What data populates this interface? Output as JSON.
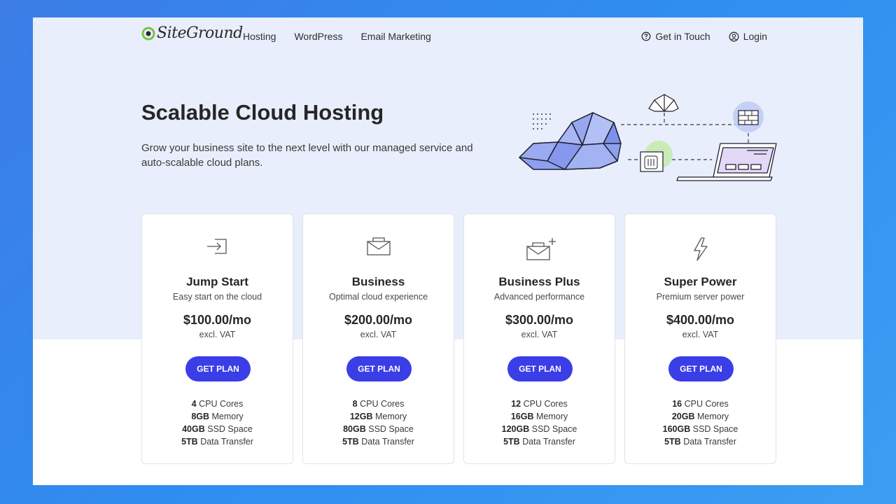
{
  "brand": {
    "name": "SiteGround",
    "accent": "#3b3ee6",
    "logo_green": "#7cc242"
  },
  "nav": {
    "links": [
      "Hosting",
      "WordPress",
      "Email Marketing"
    ],
    "contact_label": "Get in Touch",
    "login_label": "Login"
  },
  "hero": {
    "title": "Scalable Cloud Hosting",
    "subtitle": "Grow your business site to the next level with our managed service and auto-scalable cloud plans."
  },
  "plans": [
    {
      "icon": "arrow-into-box-icon",
      "name": "Jump Start",
      "tagline": "Easy start on the cloud",
      "price": "$100.00/mo",
      "vat": "excl. VAT",
      "cta": "GET PLAN",
      "specs": [
        {
          "value": "4",
          "label": "CPU Cores"
        },
        {
          "value": "8GB",
          "label": "Memory"
        },
        {
          "value": "40GB",
          "label": "SSD Space"
        },
        {
          "value": "5TB",
          "label": "Data Transfer"
        }
      ]
    },
    {
      "icon": "envelope-icon",
      "name": "Business",
      "tagline": "Optimal cloud experience",
      "price": "$200.00/mo",
      "vat": "excl. VAT",
      "cta": "GET PLAN",
      "specs": [
        {
          "value": "8",
          "label": "CPU Cores"
        },
        {
          "value": "12GB",
          "label": "Memory"
        },
        {
          "value": "80GB",
          "label": "SSD Space"
        },
        {
          "value": "5TB",
          "label": "Data Transfer"
        }
      ]
    },
    {
      "icon": "envelope-plus-icon",
      "name": "Business Plus",
      "tagline": "Advanced performance",
      "price": "$300.00/mo",
      "vat": "excl. VAT",
      "cta": "GET PLAN",
      "specs": [
        {
          "value": "12",
          "label": "CPU Cores"
        },
        {
          "value": "16GB",
          "label": "Memory"
        },
        {
          "value": "120GB",
          "label": "SSD Space"
        },
        {
          "value": "5TB",
          "label": "Data Transfer"
        }
      ]
    },
    {
      "icon": "lightning-icon",
      "name": "Super Power",
      "tagline": "Premium server power",
      "price": "$400.00/mo",
      "vat": "excl. VAT",
      "cta": "GET PLAN",
      "specs": [
        {
          "value": "16",
          "label": "CPU Cores"
        },
        {
          "value": "20GB",
          "label": "Memory"
        },
        {
          "value": "160GB",
          "label": "SSD Space"
        },
        {
          "value": "5TB",
          "label": "Data Transfer"
        }
      ]
    }
  ]
}
